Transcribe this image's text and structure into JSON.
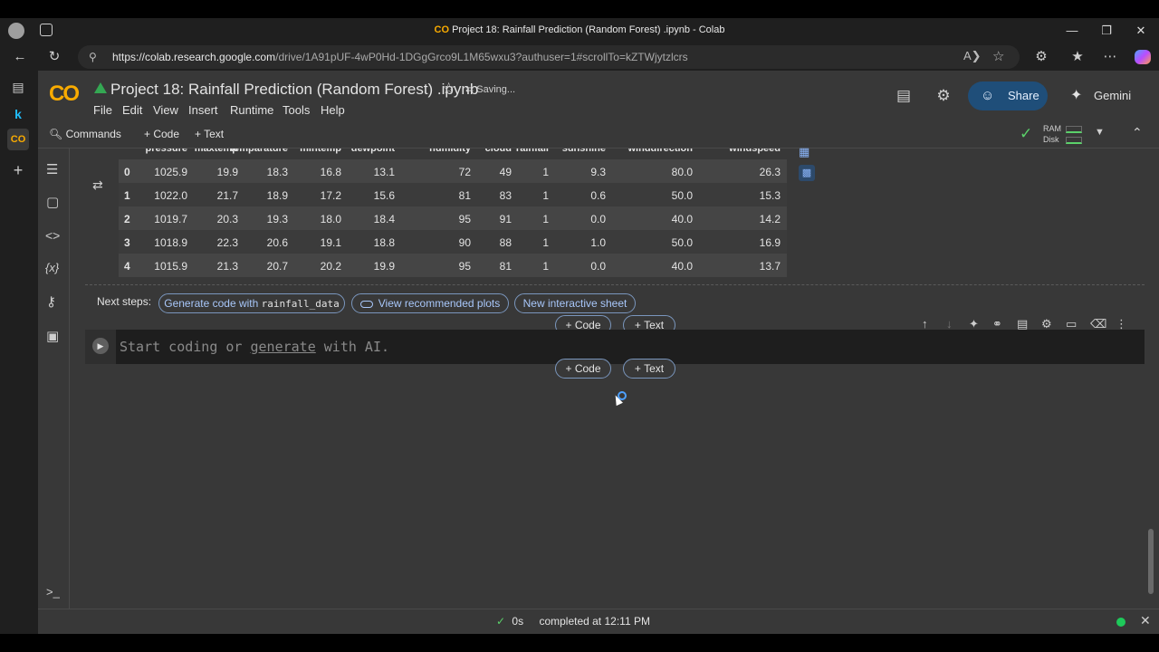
{
  "browser": {
    "tab_title": "Project 18: Rainfall Prediction (Random Forest) .ipynb - Colab",
    "url_host": "https://colab.research.google.com",
    "url_path": "/drive/1A91pUF-4wP0Hd-1DGgGrco9L1M65wxu3?authuser=1#scrollTo=kZTWjytzlcrs"
  },
  "notebook": {
    "title": "Project 18: Rainfall Prediction (Random Forest) .ipynb",
    "save_status": "Saving...",
    "logo_text": "CO"
  },
  "menu": [
    "File",
    "Edit",
    "View",
    "Insert",
    "Runtime",
    "Tools",
    "Help"
  ],
  "header": {
    "share_label": "Share",
    "gemini_label": "Gemini"
  },
  "toolbar": {
    "commands_label": "Commands",
    "add_code": "+ Code",
    "add_text": "+ Text",
    "ram_label": "RAM",
    "disk_label": "Disk"
  },
  "table": {
    "columns": [
      "",
      "pressure",
      "maxtemp",
      "temparature",
      "mintemp",
      "dewpoint",
      "humidity",
      "cloud",
      "rainfall",
      "sunshine",
      "winddirection",
      "windspeed"
    ],
    "rows": [
      [
        "0",
        "1025.9",
        "19.9",
        "18.3",
        "16.8",
        "13.1",
        "72",
        "49",
        "1",
        "9.3",
        "80.0",
        "26.3"
      ],
      [
        "1",
        "1022.0",
        "21.7",
        "18.9",
        "17.2",
        "15.6",
        "81",
        "83",
        "1",
        "0.6",
        "50.0",
        "15.3"
      ],
      [
        "2",
        "1019.7",
        "20.3",
        "19.3",
        "18.0",
        "18.4",
        "95",
        "91",
        "1",
        "0.0",
        "40.0",
        "14.2"
      ],
      [
        "3",
        "1018.9",
        "22.3",
        "20.6",
        "19.1",
        "18.8",
        "90",
        "88",
        "1",
        "1.0",
        "50.0",
        "16.9"
      ],
      [
        "4",
        "1015.9",
        "21.3",
        "20.7",
        "20.2",
        "19.9",
        "95",
        "81",
        "1",
        "0.0",
        "40.0",
        "13.7"
      ]
    ]
  },
  "next_steps": {
    "label": "Next steps:",
    "generate_prefix": "Generate code with ",
    "generate_var": "rainfall_data",
    "view_plots": "View recommended plots",
    "interactive_sheet": "New interactive sheet"
  },
  "cell_adders": {
    "code": "Code",
    "text": "Text"
  },
  "empty_cell": {
    "placeholder_start": "Start coding or ",
    "placeholder_link": "generate",
    "placeholder_end": " with AI."
  },
  "status": {
    "duration": "0s",
    "message": "completed at 12:11 PM"
  }
}
